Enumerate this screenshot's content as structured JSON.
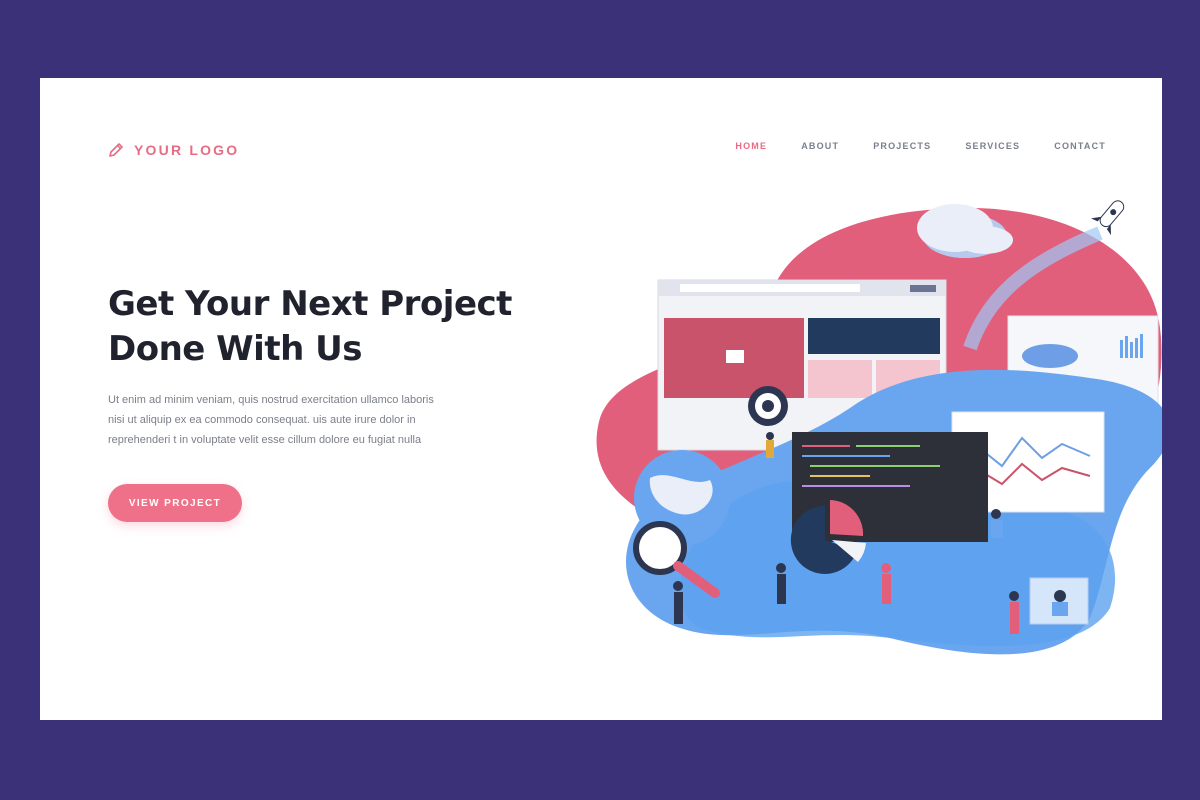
{
  "brand": {
    "logo_text": "YOUR LOGO",
    "logo_icon": "pencil-icon"
  },
  "nav": {
    "items": [
      {
        "label": "HOME",
        "active": true
      },
      {
        "label": "ABOUT",
        "active": false
      },
      {
        "label": "PROJECTS",
        "active": false
      },
      {
        "label": "SERVICES",
        "active": false
      },
      {
        "label": "CONTACT",
        "active": false
      }
    ]
  },
  "hero": {
    "title_line1": "Get Your Next Project",
    "title_line2": "Done With Us",
    "body_line1": "Ut enim ad minim veniam, quis nostrud exercitation ullamco laboris",
    "body_line2": "nisi ut aliquip ex ea commodo consequat. uis aute irure dolor in",
    "body_line3": "reprehenderi t in voluptate velit esse cillum dolore eu fugiat nulla",
    "cta_label": "VIEW PROJECT"
  },
  "colors": {
    "background": "#3a3178",
    "accent": "#ef7189",
    "heading": "#20222e",
    "blob_pink": "#e25f7c",
    "blob_blue": "#6aa6ef"
  }
}
